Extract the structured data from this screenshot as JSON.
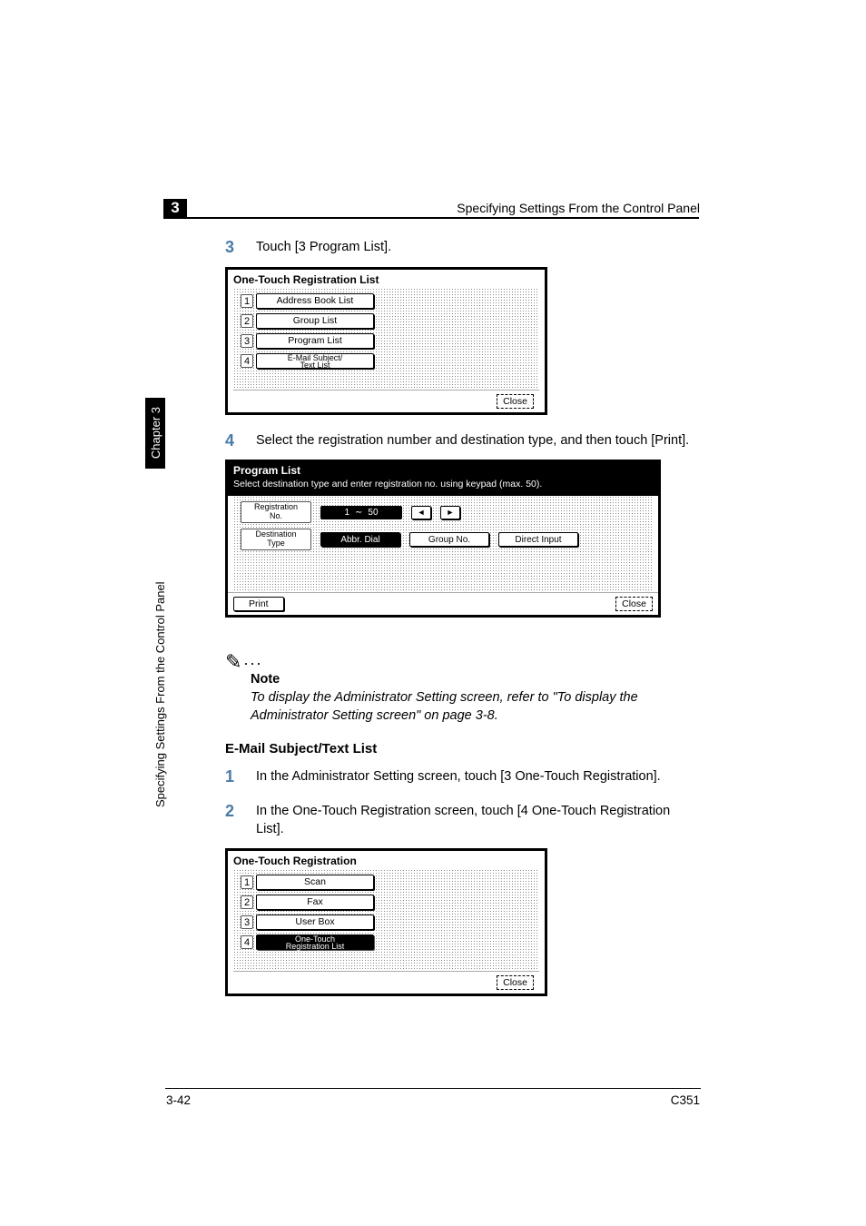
{
  "header": {
    "chapter_badge": "3",
    "running": "Specifying Settings From the Control Panel"
  },
  "sidebar": {
    "tab": "Chapter 3",
    "vertical": "Specifying Settings From the Control Panel"
  },
  "steps_a": {
    "s3": {
      "num": "3",
      "text": "Touch [3 Program List]."
    },
    "s4": {
      "num": "4",
      "text": "Select the registration number and destination type, and then touch [Print]."
    }
  },
  "panel1": {
    "title": "One-Touch Registration List",
    "items": [
      {
        "n": "1",
        "label": "Address Book List"
      },
      {
        "n": "2",
        "label": "Group List"
      },
      {
        "n": "3",
        "label": "Program List"
      },
      {
        "n": "4",
        "label": "E-Mail Subject/\nText List"
      }
    ],
    "close": "Close"
  },
  "panel2": {
    "title": "Program List",
    "sub": "Select destination type and enter registration no. using keypad (max. 50).",
    "reg_label": "Registration\nNo.",
    "range_from": "1",
    "range_tilde": "∼",
    "range_to": "50",
    "dest_label": "Destination\nType",
    "dest_buttons": [
      "Abbr. Dial",
      "Group No.",
      "Direct Input"
    ],
    "print": "Print",
    "close": "Close"
  },
  "note": {
    "title": "Note",
    "text": "To display the Administrator Setting screen, refer to \"To display the Administrator Setting screen\" on page 3-8."
  },
  "section2": {
    "heading": "E-Mail Subject/Text List",
    "s1": {
      "num": "1",
      "text": "In the Administrator Setting screen, touch [3 One-Touch Registration]."
    },
    "s2": {
      "num": "2",
      "text": "In the One-Touch Registration screen, touch [4 One-Touch Registration List]."
    }
  },
  "panel3": {
    "title": "One-Touch Registration",
    "items": [
      {
        "n": "1",
        "label": "Scan"
      },
      {
        "n": "2",
        "label": "Fax"
      },
      {
        "n": "3",
        "label": "User Box"
      },
      {
        "n": "4",
        "label": "One-Touch\nRegistration List"
      }
    ],
    "close": "Close"
  },
  "footer": {
    "page": "3-42",
    "model": "C351"
  }
}
